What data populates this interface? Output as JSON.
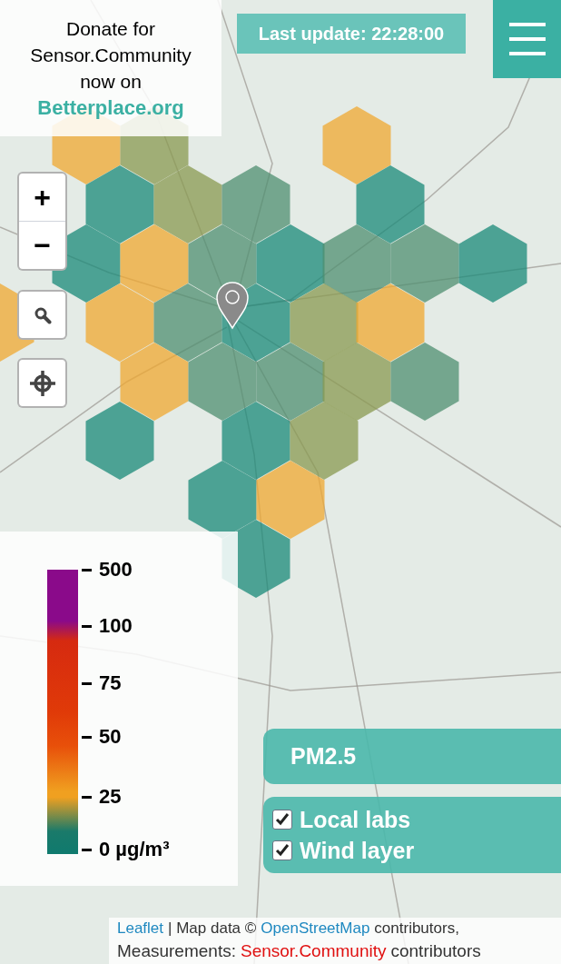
{
  "donate": {
    "lines": [
      "Donate for",
      "Sensor.Community",
      "now on"
    ],
    "link": "Betterplace.org"
  },
  "last_update": "Last update: 22:28:00",
  "zoom": {
    "in": "+",
    "out": "−"
  },
  "legend": {
    "ticks": [
      "500",
      "100",
      "75",
      "50",
      "25",
      "0 µg/m³"
    ]
  },
  "pollutant": "PM2.5",
  "layers": [
    {
      "label": "Local labs",
      "checked": true
    },
    {
      "label": "Wind layer",
      "checked": true
    }
  ],
  "attribution": [
    [
      {
        "kind": "link",
        "text": "Leaflet"
      },
      {
        "kind": "text",
        "text": "| Map data ©"
      },
      {
        "kind": "link",
        "text": "OpenStreetMap"
      },
      {
        "kind": "text",
        "text": "contributors,"
      }
    ],
    [
      {
        "kind": "text",
        "text": "Measurements:"
      },
      {
        "kind": "brand",
        "text": "Sensor.Community"
      },
      {
        "kind": "text",
        "text": "contributors"
      }
    ]
  ]
}
